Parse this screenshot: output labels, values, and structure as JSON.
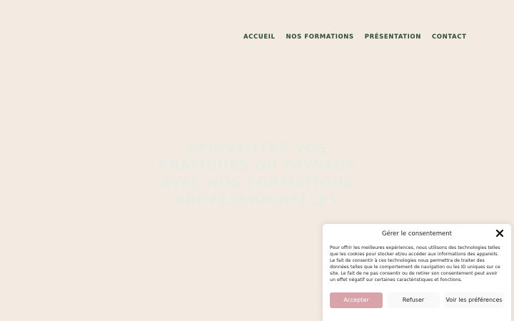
{
  "nav": {
    "items": [
      {
        "label": "ACCUEIL"
      },
      {
        "label": "NOS FORMATIONS"
      },
      {
        "label": "PRÉSENTATION"
      },
      {
        "label": "CONTACT"
      }
    ]
  },
  "hero": {
    "line1": "RÉINVENTEZ VOS",
    "line2": "PRATIQUES DU PAYSAGE",
    "line3": "AVEC NOS FORMATIONS",
    "line4": "PROFESSIONNELLES"
  },
  "consent": {
    "title": "Gérer le consentement",
    "close_icon": "close-icon",
    "body": "Pour offrir les meilleures expériences, nous utilisons des technologies telles que les cookies pour stocker et/ou accéder aux informations des appareils. Le fait de consentir à ces technologies nous permettra de traiter des données telles que le comportement de navigation ou les ID uniques sur ce site. Le fait de ne pas consentir ou de retirer son consentement peut avoir un effet négatif sur certaines caractéristiques et fonctions.",
    "accept_label": "Accepter",
    "refuse_label": "Refuser",
    "prefs_label": "Voir les préférences",
    "accent_color": "#d9a3aa"
  },
  "colors": {
    "background": "#f3ebe2",
    "nav_text": "#2d4a38"
  }
}
